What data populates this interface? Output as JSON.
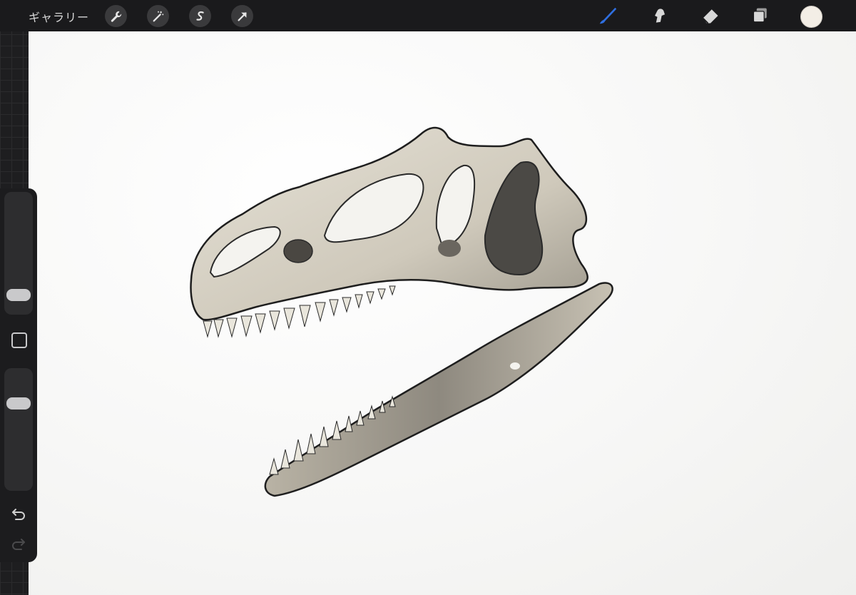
{
  "topbar": {
    "gallery_label": "ギャラリー",
    "left_tools": [
      {
        "icon": "wrench-icon"
      },
      {
        "icon": "magic-wand-icon"
      },
      {
        "icon": "selection-s-icon"
      },
      {
        "icon": "transform-arrow-icon"
      }
    ],
    "right_tools": [
      {
        "icon": "brush-icon",
        "active": true
      },
      {
        "icon": "smudge-icon"
      },
      {
        "icon": "eraser-icon"
      },
      {
        "icon": "layers-icon"
      }
    ],
    "current_color": "#f3eee6"
  },
  "sidebar": {
    "brush_size_slider": 0.18,
    "opacity_slider": 0.7,
    "modify_button_icon": "square-icon",
    "undo_icon": "undo-icon",
    "redo_icon": "redo-icon"
  },
  "colors": {
    "accent_brush": "#2f6fe0",
    "paper": "#f7f7f6",
    "bone": "#d8d3c6",
    "bone_shadow": "#6f6b63",
    "outline": "#1e1e1e"
  }
}
